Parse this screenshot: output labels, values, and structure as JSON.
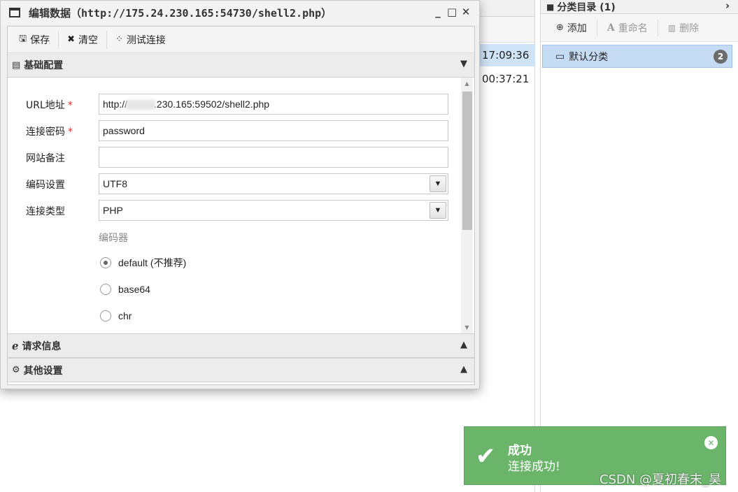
{
  "dialog": {
    "title": "编辑数据（http://175.24.230.165:54730/shell2.php）",
    "controls": {
      "minimize": "_",
      "maximize": "□",
      "close": "✕"
    }
  },
  "toolbar": {
    "save_label": "保存",
    "clear_label": "清空",
    "test_label": "测试连接"
  },
  "sections": {
    "basic": "基础配置",
    "request": "请求信息",
    "other": "其他设置"
  },
  "form": {
    "url_label": "URL地址",
    "url_prefix": "http://",
    "url_suffix": ".230.165:59502/shell2.php",
    "password_label": "连接密码",
    "password_value": "password",
    "note_label": "网站备注",
    "note_value": "",
    "encoding_label": "编码设置",
    "encoding_value": "UTF8",
    "type_label": "连接类型",
    "type_value": "PHP",
    "required_mark": "*",
    "encoder_label": "编码器",
    "encoders": [
      {
        "label": "default (不推荐)",
        "checked": true
      },
      {
        "label": "base64",
        "checked": false
      },
      {
        "label": "chr",
        "checked": false
      }
    ]
  },
  "background_list": {
    "times": [
      "17:09:36",
      "00:37:21"
    ]
  },
  "category_panel": {
    "title": "分类目录 (1)",
    "add_label": "添加",
    "rename_label": "重命名",
    "delete_label": "删除",
    "items": [
      {
        "label": "默认分类",
        "count": "2"
      }
    ]
  },
  "toast": {
    "title": "成功",
    "message": "连接成功!",
    "color": "#6bb56b"
  },
  "watermark": "CSDN @夏初春末_昊"
}
